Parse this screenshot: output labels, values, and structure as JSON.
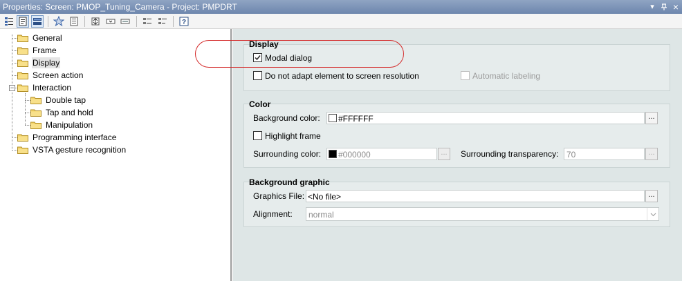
{
  "window": {
    "title": "Properties: Screen: PMOP_Tuning_Camera - Project: PMPDRT",
    "controls": {
      "dropdown": "▾",
      "pin": "ㅐ",
      "close": "×"
    }
  },
  "toolbar": {
    "buttons": [
      {
        "name": "categorized-icon"
      },
      {
        "name": "properties-page-icon"
      },
      {
        "name": "events-icon"
      },
      {
        "name": "favorites-star-icon"
      },
      {
        "name": "description-icon"
      },
      {
        "name": "expand-all-icon"
      },
      {
        "name": "collapse-icon"
      },
      {
        "name": "field-icon"
      },
      {
        "name": "list-view-icon"
      },
      {
        "name": "list-view-alt-icon"
      },
      {
        "name": "help-icon"
      }
    ]
  },
  "tree": {
    "items": [
      {
        "label": "General"
      },
      {
        "label": "Frame"
      },
      {
        "label": "Display",
        "selected": true
      },
      {
        "label": "Screen action"
      },
      {
        "label": "Interaction",
        "expanded": true
      },
      {
        "label": "Double tap"
      },
      {
        "label": "Tap and hold"
      },
      {
        "label": "Manipulation"
      },
      {
        "label": "Programming interface"
      },
      {
        "label": "VSTA gesture recognition"
      }
    ],
    "expander_symbol": "−"
  },
  "display": {
    "title": "Display",
    "modal_dialog": {
      "label": "Modal dialog",
      "checked": true
    },
    "no_adapt": {
      "label": "Do not adapt element to screen resolution",
      "checked": false
    },
    "auto_labeling": {
      "label": "Automatic labeling",
      "checked": false,
      "enabled": false
    }
  },
  "color": {
    "title": "Color",
    "background": {
      "label": "Background color:",
      "value": "#FFFFFF",
      "swatch": "#FFFFFF",
      "button": "..."
    },
    "highlight_frame": {
      "label": "Highlight frame",
      "checked": false
    },
    "surrounding": {
      "label": "Surrounding color:",
      "value": "#000000",
      "swatch": "#000000",
      "button": "..."
    },
    "transparency": {
      "label": "Surrounding transparency:",
      "value": "70",
      "button": "..."
    }
  },
  "background_graphic": {
    "title": "Background graphic",
    "graphics_file": {
      "label": "Graphics File:",
      "value": "<No file>",
      "button": "..."
    },
    "alignment": {
      "label": "Alignment:",
      "value": "normal"
    }
  },
  "colors": {
    "accent_ring": "#D42A2A",
    "titlebar": "#7A91B8",
    "panel": "#DEE6E6"
  }
}
